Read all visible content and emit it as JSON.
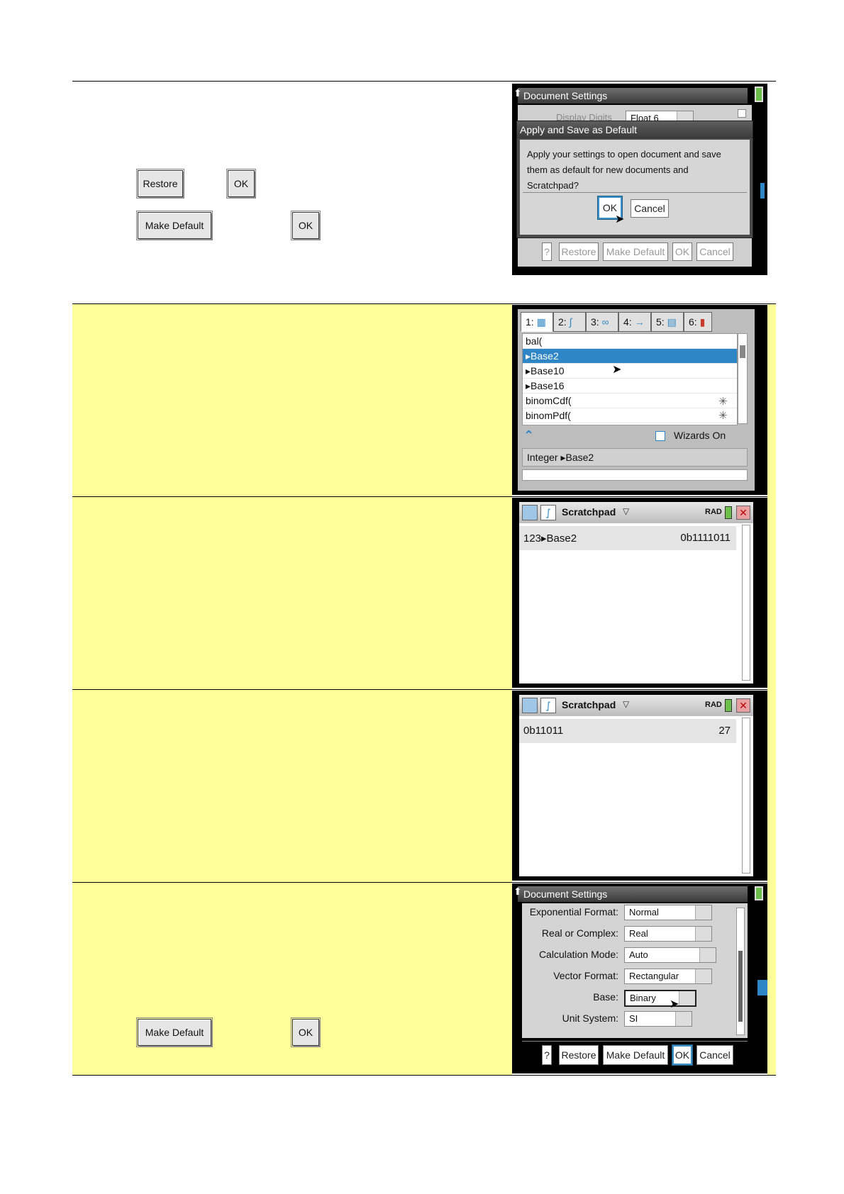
{
  "left_buttons": {
    "restore_label": "Restore",
    "ok_label": "OK",
    "make_default_label": "Make Default"
  },
  "screen1": {
    "title": "Document Settings",
    "behind_label": "Display Digits",
    "behind_value": "Float 6",
    "dialog_title": "Apply and Save as Default",
    "dialog_text_1": "Apply your settings to open document and save",
    "dialog_text_2": "them as default for new documents and",
    "dialog_text_3": "Scratchpad?",
    "ok": "OK",
    "cancel": "Cancel",
    "bottom": {
      "help": "?",
      "restore": "Restore",
      "make_default": "Make Default",
      "ok": "OK",
      "cancel": "Cancel"
    }
  },
  "screen2": {
    "tabs": [
      "1:",
      "2:",
      "3:",
      "4:",
      "5:",
      "6:"
    ],
    "items": [
      "bal(",
      "▸Base2",
      "▸Base10",
      "▸Base16",
      "binomCdf(",
      "binomPdf("
    ],
    "wizards": "Wizards On",
    "syntax": "Integer ▸Base2"
  },
  "screen3": {
    "app_title": "Scratchpad",
    "mode": "RAD",
    "input": "123▸Base2",
    "result": "0b1111011"
  },
  "screen4": {
    "app_title": "Scratchpad",
    "mode": "RAD",
    "input": "0b11011",
    "result": "27"
  },
  "screen5": {
    "title": "Document Settings",
    "settings": [
      {
        "label": "Exponential Format:",
        "value": "Normal"
      },
      {
        "label": "Real or Complex:",
        "value": "Real"
      },
      {
        "label": "Calculation Mode:",
        "value": "Auto"
      },
      {
        "label": "Vector Format:",
        "value": "Rectangular"
      },
      {
        "label": "Base:",
        "value": "Binary"
      },
      {
        "label": "Unit System:",
        "value": "SI"
      }
    ],
    "bottom": {
      "help": "?",
      "restore": "Restore",
      "make_default": "Make Default",
      "ok": "OK",
      "cancel": "Cancel"
    }
  },
  "colors": {
    "highlight": "#ffff99",
    "selection": "#2f86c6"
  }
}
